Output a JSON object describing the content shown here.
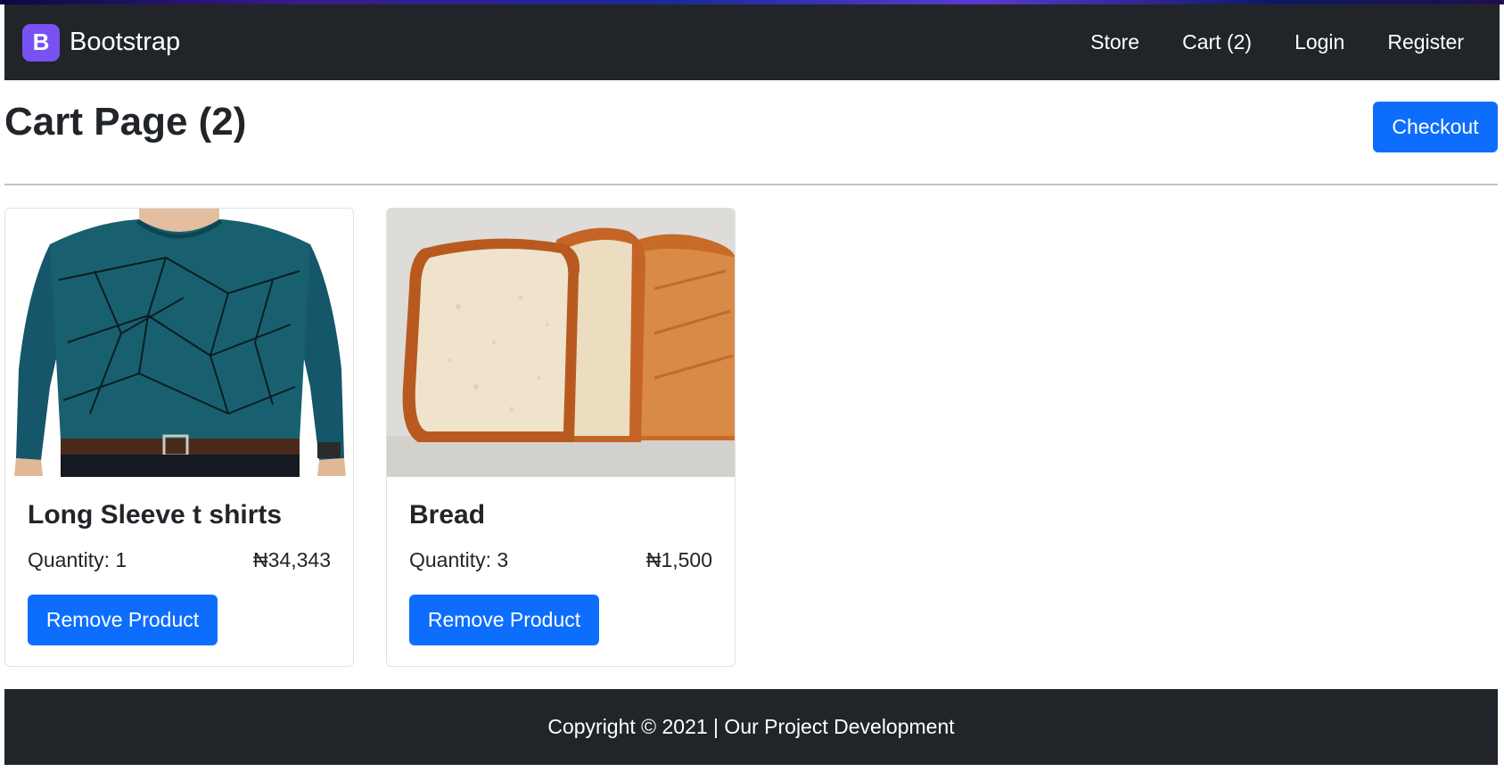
{
  "navbar": {
    "brand_icon": "bootstrap-logo-icon",
    "brand_letter": "B",
    "brand_text": "Bootstrap",
    "links": [
      "Store",
      "Cart (2)",
      "Login",
      "Register"
    ]
  },
  "page": {
    "title": "Cart Page (2)",
    "checkout_label": "Checkout"
  },
  "products": [
    {
      "image": "long-sleeve-shirt-image",
      "name": "Long Sleeve t shirts",
      "quantity_text": "Quantity: 1",
      "price": "₦34,343",
      "remove_label": "Remove Product"
    },
    {
      "image": "bread-image",
      "name": "Bread",
      "quantity_text": "Quantity: 3",
      "price": "₦1,500",
      "remove_label": "Remove Product"
    }
  ],
  "footer": {
    "text": "Copyright © 2021 | Our Project Development"
  },
  "colors": {
    "navbar_bg": "#212529",
    "primary": "#0d6efd",
    "brand": "#7952f3"
  }
}
